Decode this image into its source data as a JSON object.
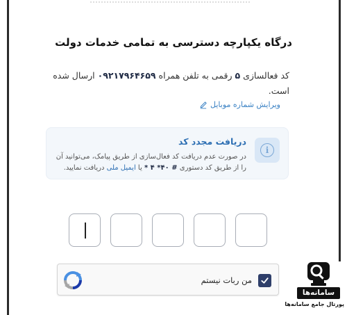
{
  "page": {
    "title": "درگاه یکپارچه دسترسی به تمامی خدمات دولت"
  },
  "verification": {
    "text_part1": "کد فعالسازی",
    "digits": "۵",
    "text_part2": "رقمی به تلفن همراه",
    "phone": "۰۹۲۱۷۹۶۴۶۵۹",
    "text_part3": "ارسال شده است.",
    "edit_label": "ویرایش شماره موبایل"
  },
  "resend": {
    "title": "دریافت مجدد کد",
    "text_part1": "در صورت عدم دریافت کد فعال‌سازی از طریق پیامک، می‌توانید آن را از طریق کد دستوری",
    "ussd_code": "# ۴۰* ۴ *",
    "text_part2": "یا",
    "email_link": "ایمیل ملی",
    "text_part3": "دریافت نمایید."
  },
  "otp": {
    "digits": [
      "",
      "",
      "",
      "",
      ""
    ],
    "active_index": 4
  },
  "captcha": {
    "label": "من ربات نیستم",
    "checked": true
  },
  "brand": {
    "name": "سامانه‌ها",
    "tagline": "پورتال جامع سامانه‌ها"
  },
  "colors": {
    "accent": "#2d6fb3",
    "link": "#3b82c4",
    "info_bg": "#f3f7fb",
    "checkbox": "#2f3f6a"
  }
}
